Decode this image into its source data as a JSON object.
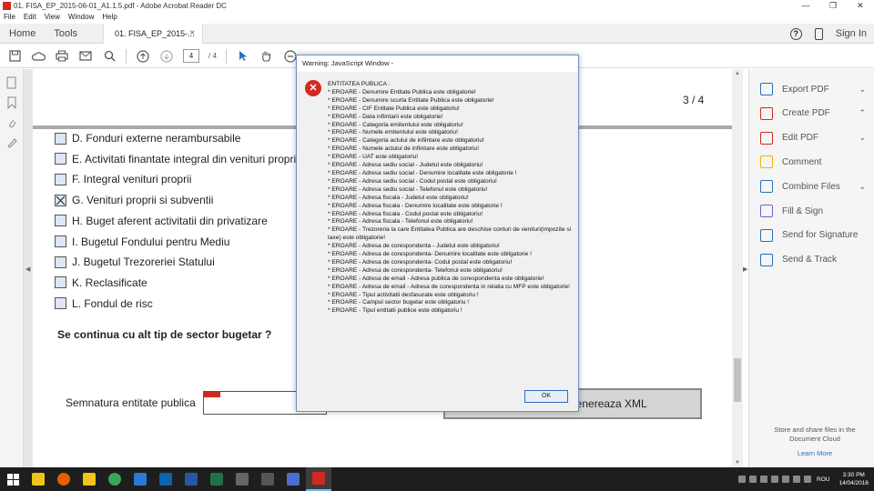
{
  "window": {
    "title": "01. FISA_EP_2015-06-01_A1.1.5.pdf - Adobe Acrobat Reader DC",
    "minimize": "—",
    "maximize": "❐",
    "close": "✕"
  },
  "menu": [
    "File",
    "Edit",
    "View",
    "Window",
    "Help"
  ],
  "tabs": {
    "home": "Home",
    "tools": "Tools",
    "doc": "01. FISA_EP_2015-...",
    "close": "×",
    "signin": "Sign In"
  },
  "toolbar": {
    "page_current": "4",
    "page_total": "/ 4"
  },
  "document": {
    "page_number": "3 / 4",
    "options": [
      {
        "label": "D. Fonduri externe nerambursabile",
        "checked": false
      },
      {
        "label": "E. Activitati finantate integral din venituri propri",
        "checked": false
      },
      {
        "label": "F. Integral venituri proprii",
        "checked": false
      },
      {
        "label": "G. Venituri proprii si subventii",
        "checked": true
      },
      {
        "label": "H. Buget aferent activitatii din privatizare",
        "checked": false
      },
      {
        "label": "I. Bugetul Fondului pentru Mediu",
        "checked": false
      },
      {
        "label": "J. Bugetul Trezoreriei Statului",
        "checked": false
      },
      {
        "label": "K. Reclasificate",
        "checked": false
      },
      {
        "label": "L. Fondul de risc",
        "checked": false
      }
    ],
    "question": "Se continua cu alt tip de sector bugetar ?",
    "signature_label": "Semnatura entitate publica",
    "xml_button": "genereaza XML"
  },
  "right_panel": {
    "items": [
      {
        "label": "Export PDF",
        "icon": "export-pdf-icon",
        "color": "#2a6ebb",
        "chevron": "⌄"
      },
      {
        "label": "Create PDF",
        "icon": "create-pdf-icon",
        "color": "#d12b1f",
        "chevron": "⌃"
      },
      {
        "label": "Edit PDF",
        "icon": "edit-pdf-icon",
        "color": "#d12b1f",
        "chevron": "⌄"
      },
      {
        "label": "Comment",
        "icon": "comment-icon",
        "color": "#f0b400",
        "chevron": ""
      },
      {
        "label": "Combine Files",
        "icon": "combine-files-icon",
        "color": "#2a6ebb",
        "chevron": "⌄"
      },
      {
        "label": "Fill & Sign",
        "icon": "fill-sign-icon",
        "color": "#7a5fc0",
        "chevron": ""
      },
      {
        "label": "Send for Signature",
        "icon": "send-signature-icon",
        "color": "#2a6ebb",
        "chevron": ""
      },
      {
        "label": "Send & Track",
        "icon": "send-track-icon",
        "color": "#2a6ebb",
        "chevron": ""
      }
    ],
    "footer": "Store and share files in the Document Cloud",
    "learn_more": "Learn More"
  },
  "dialog": {
    "title": "Warning: JavaScript Window -",
    "lines": [
      "ENTITATEA PUBLICA :",
      "* EROARE - Denumire Entitate Publica este obligatorie!",
      "* EROARE - Denumire scurta Entitate Publica este obligatorie!",
      "* EROARE - CIF Entitate Publica este obligatoriu!",
      "* EROARE - Data infiintarii este obligatorie!",
      "* EROARE - Categoria emitentului este obligatoriu!",
      "* EROARE - Numele emitentului este obligatoriu!",
      "* EROARE - Categoria actului de infiintare este obligatoriu!",
      "* EROARE - Numele actului de infiintare este obligatoriu!",
      "* EROARE - UAT este obligatoriu!",
      "* EROARE - Adresa sediu social - Judetul este obligatoriu!",
      "* EROARE - Adresa sediu social - Denumire localitate este obligatorie !",
      "* EROARE - Adresa sediu social - Codul postal este obligatoriu!",
      "* EROARE - Adresa sediu social - Telefonul este obligatoriu!",
      "* EROARE - Adresa fiscala - Judetul este obligatoriu!",
      "* EROARE - Adresa fiscala - Denumire localitate este obligatorie !",
      "* EROARE - Adresa fiscala - Codul postal este obligatoriu!",
      "* EROARE - Adresa fiscala - Telefonul este obligatoriu!",
      "* EROARE - Trezoreria la care Entitatea Publica are deschise conturi de venituri(impozite si taxe) este obligatorie!",
      "* EROARE - Adresa de corespondenta - Judetul este obligatoriu!",
      "* EROARE - Adresa de corespondenta- Denumire localitate este obligatorie !",
      "* EROARE - Adresa de corespondenta- Codul postal este obligatoriu!",
      "* EROARE - Adresa de corespondenta- Telefonul este obligatoriu!",
      "* EROARE - Adresa de email - Adresa publica de corespondenta este obligatorie!",
      "* EROARE - Adresa de email - Adresa de corespondenta in relatia cu MFP este obligatorie!",
      "* EROARE - Tipul activitatii desfasurate este obligatoriu !",
      "* EROARE - Campul sector bugetar este obligatoriu !",
      "* EROARE - Tipul entitatii publice este obligatoriu !"
    ],
    "ok": "OK"
  },
  "taskbar": {
    "apps": [
      {
        "name": "file-explorer",
        "color": "#f0c419"
      },
      {
        "name": "firefox",
        "color": "#e66000"
      },
      {
        "name": "explorer-folder",
        "color": "#f0c419"
      },
      {
        "name": "chrome",
        "color": "#3aa757"
      },
      {
        "name": "edge",
        "color": "#2a7ad5"
      },
      {
        "name": "outlook",
        "color": "#0a64ad"
      },
      {
        "name": "word",
        "color": "#2b579a"
      },
      {
        "name": "excel",
        "color": "#217346"
      },
      {
        "name": "calculator",
        "color": "#666666"
      },
      {
        "name": "store",
        "color": "#555555"
      },
      {
        "name": "library",
        "color": "#4a6fd0"
      },
      {
        "name": "acrobat",
        "color": "#d12b1f"
      }
    ],
    "lang": "ROU",
    "time": "3:30 PM",
    "date": "14/04/2016"
  }
}
